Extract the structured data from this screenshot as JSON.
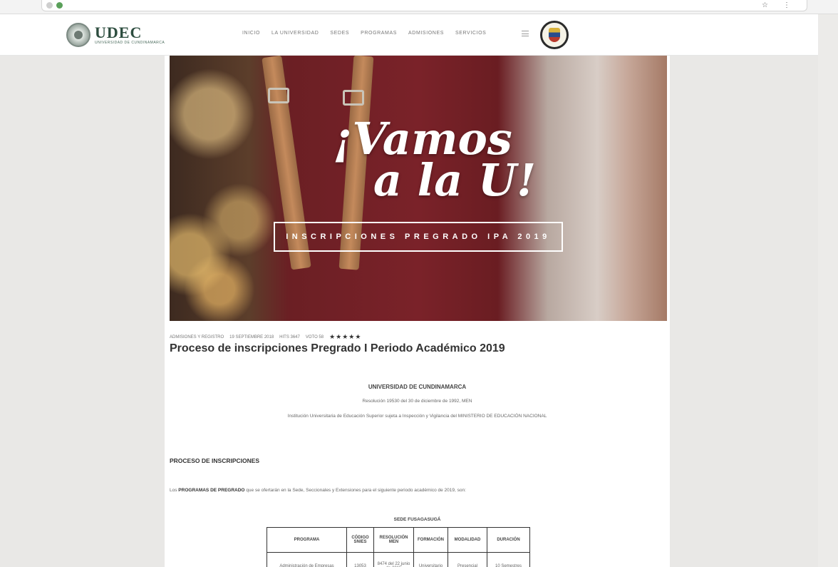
{
  "site": {
    "logo_title": "UDEC",
    "logo_subtitle": "UNIVERSIDAD DE CUNDINAMARCA"
  },
  "nav": {
    "items": [
      "INICIO",
      "LA UNIVERSIDAD",
      "SEDES",
      "PROGRAMAS",
      "ADMISIONES",
      "SERVICIOS"
    ]
  },
  "hero": {
    "title_line1": "¡Vamos",
    "title_line2": "a la U!",
    "banner": "INSCRIPCIONES PREGRADO IPA 2019"
  },
  "post": {
    "meta": {
      "category": "ADMISIONES Y REGISTRO",
      "date": "19 SEPTIEMBRE 2018",
      "author": "HITS 3647",
      "rating": "VOTO 58",
      "stars": "★★★★★"
    },
    "title": "Proceso de inscripciones Pregrado I Periodo Académico 2019"
  },
  "body": {
    "university": "UNIVERSIDAD DE CUNDINAMARCA",
    "resolution": "Resolución 19530 del 30 de diciembre de 1992, MEN",
    "institution": "Institución Universitaria de Educación Superior sujeta a Inspección y Vigilancia del MINISTERIO DE EDUCACIÓN NACIONAL",
    "section_heading": "PROCESO DE INSCRIPCIONES",
    "intro_prefix": "Los",
    "intro_bold": "PROGRAMAS DE PREGRADO",
    "intro_suffix": "que se ofertarán en la Sede, Seccionales y Extensiones para el siguiente periodo académico de 2019, son:",
    "sede": "SEDE FUSAGASUGÁ"
  },
  "table": {
    "headers": [
      "PROGRAMA",
      "CÓDIGO SNIES",
      "RESOLUCIÓN MEN",
      "FORMACIÓN",
      "MODALIDAD",
      "DURACIÓN"
    ],
    "rows": [
      [
        "Administración de Empresas",
        "13053",
        "8474 del 22 junio de 2015",
        "Universitario",
        "Presencial",
        "10 Semestres"
      ]
    ]
  }
}
